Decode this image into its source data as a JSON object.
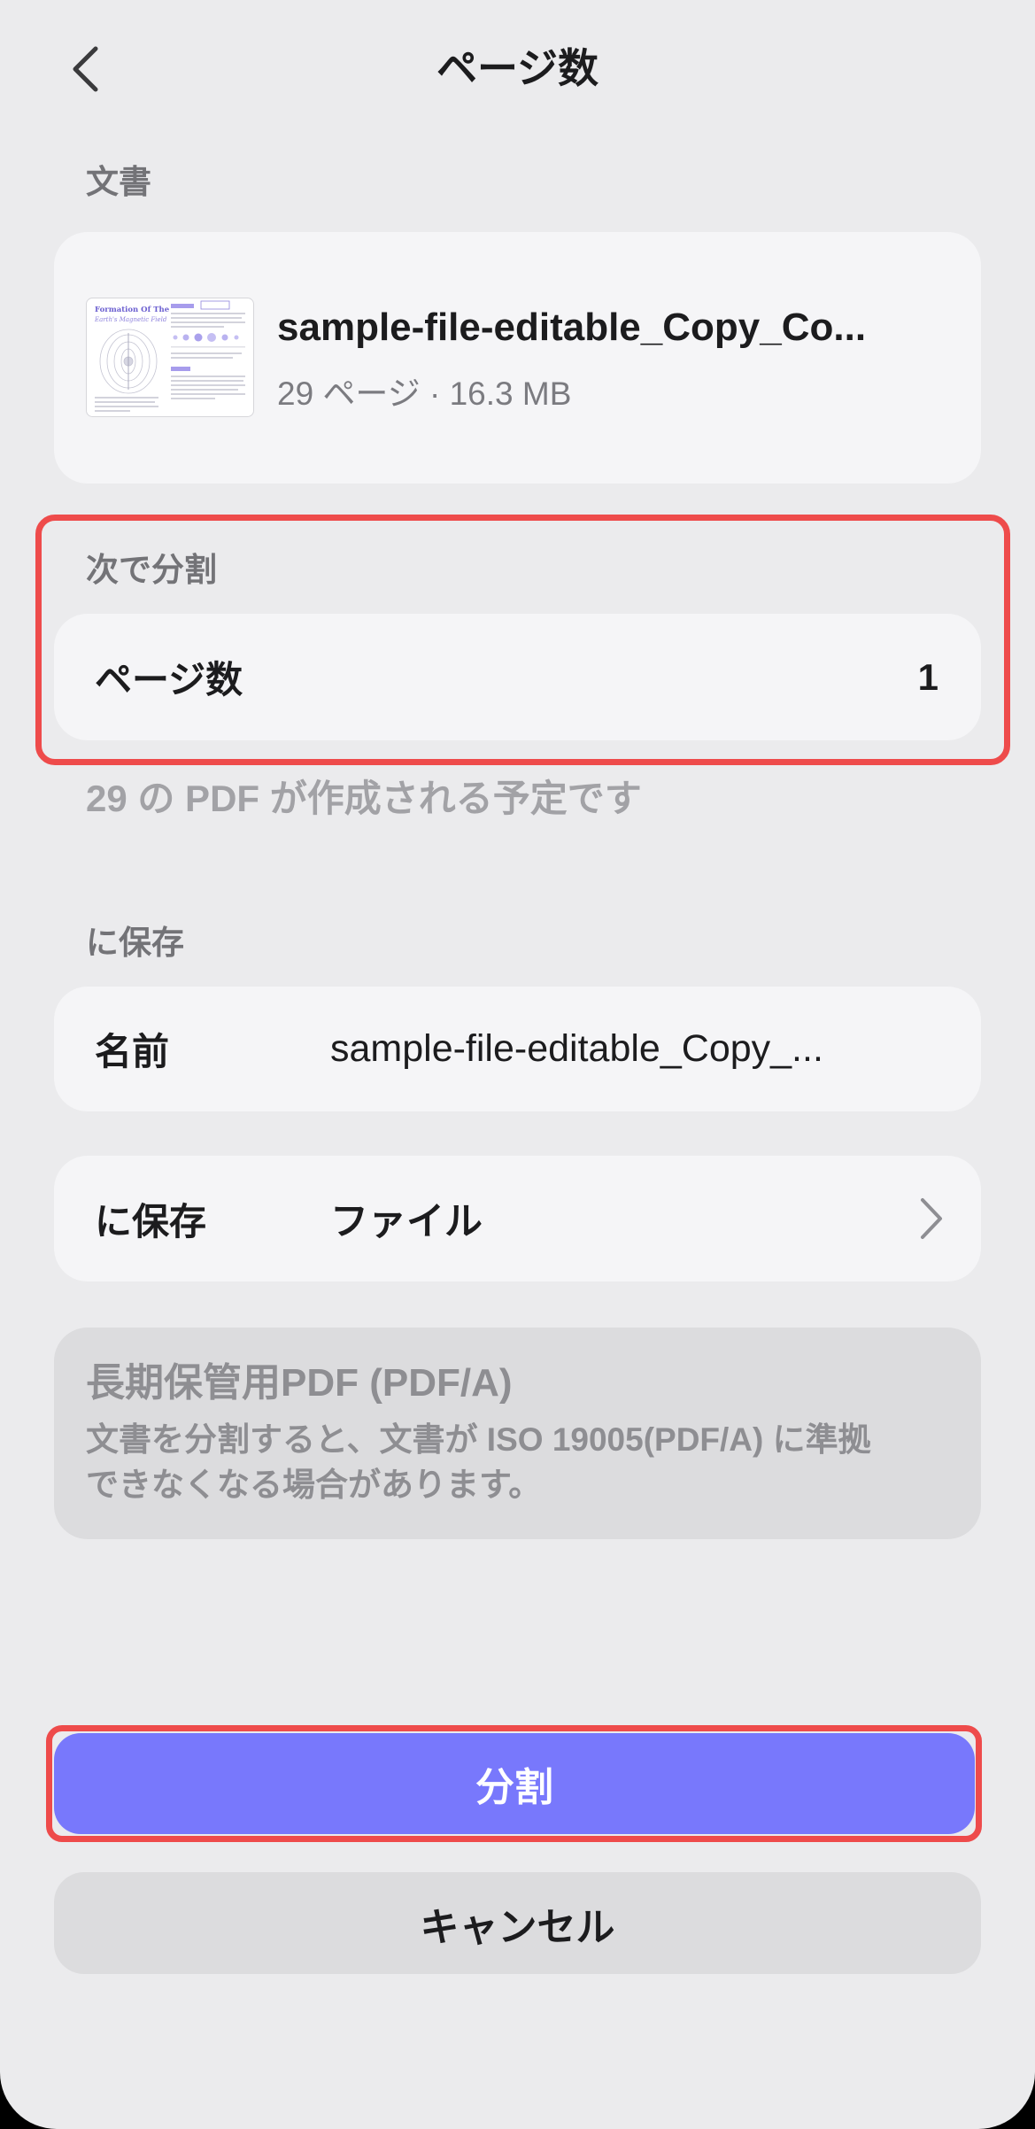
{
  "header": {
    "title": "ページ数",
    "back_icon": "chevron-left-icon"
  },
  "document_section": {
    "label": "文書",
    "file_name": "sample-file-editable_Copy_Co...",
    "meta": "29 ページ · 16.3 MB",
    "thumbnail": {
      "title_line1": "Formation Of The",
      "title_line2": "Earth's Magnetic Field"
    }
  },
  "split_section": {
    "label": "次で分割",
    "option_label": "ページ数",
    "option_value": "1",
    "note": "29 の PDF が作成される予定です"
  },
  "save_section": {
    "label": "に保存",
    "name_label": "名前",
    "name_value": "sample-file-editable_Copy_...",
    "location_label": "に保存",
    "location_value": "ファイル",
    "location_icon": "chevron-right-icon"
  },
  "pdfa_notice": {
    "title": "長期保管用PDF (PDF/A)",
    "description_line1": "文書を分割すると、文書が ISO 19005(PDF/A) に準拠",
    "description_line2": "できなくなる場合があります。"
  },
  "actions": {
    "split_label": "分割",
    "cancel_label": "キャンセル"
  },
  "colors": {
    "background": "#ebebed",
    "card": "#f5f5f7",
    "primary": "#7878fc",
    "highlight": "#ee4b4b",
    "notice_background": "#dcdcde"
  }
}
